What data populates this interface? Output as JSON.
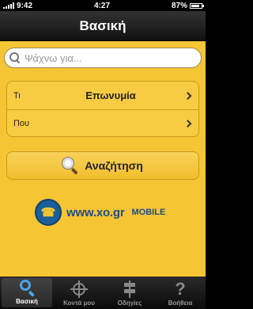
{
  "status_bar": {
    "time": "9:42",
    "clock": "4:27",
    "battery": "87%",
    "battery_level": 0.87
  },
  "nav": {
    "title": "Βασική"
  },
  "search": {
    "placeholder": "Ψάχνω για..."
  },
  "form": {
    "rows": [
      {
        "label": "Τι",
        "value": "Επωνυμία"
      },
      {
        "label": "Που",
        "value": ""
      }
    ]
  },
  "search_button": {
    "label": "Αναζήτηση"
  },
  "logo": {
    "text": "www.xo.gr",
    "suffix": "MOBILE"
  },
  "tabs": [
    {
      "label": "Βασική",
      "icon": "search-icon",
      "active": true
    },
    {
      "label": "Κοντά μου",
      "icon": "crosshair-icon",
      "active": false
    },
    {
      "label": "Οδηγίες",
      "icon": "signpost-icon",
      "active": false
    },
    {
      "label": "Βοήθεια",
      "icon": "question-icon",
      "active": false
    }
  ],
  "colors": {
    "accent": "#f5c533",
    "tab_active": "#4aa3e8"
  }
}
